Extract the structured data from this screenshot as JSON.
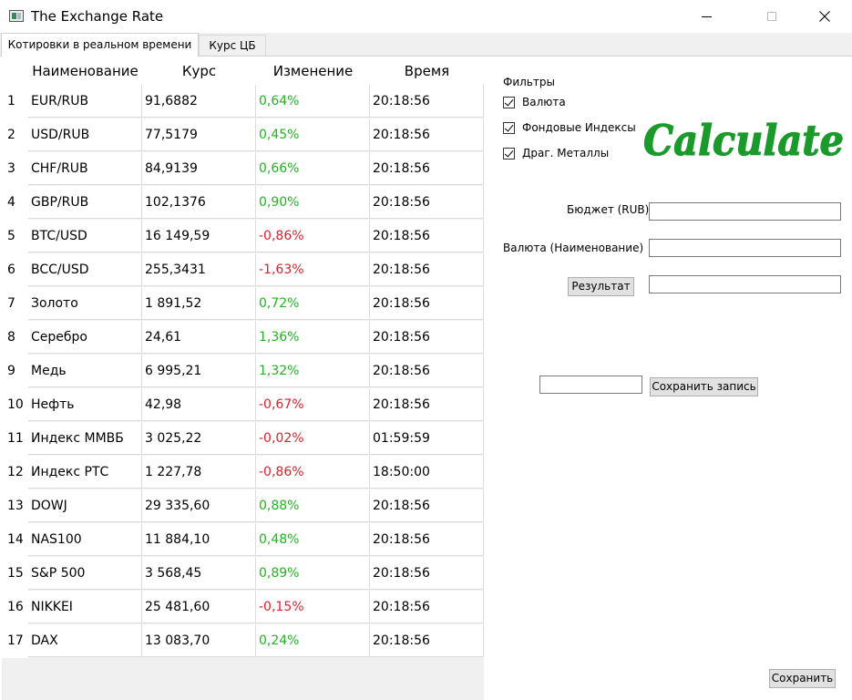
{
  "window": {
    "title": "The Exchange Rate"
  },
  "tabs": [
    {
      "label": "Котировки в реальном времени"
    },
    {
      "label": "Курс ЦБ"
    }
  ],
  "table": {
    "headers": [
      "Наименование",
      "Курс",
      "Изменение",
      "Время"
    ],
    "rows": [
      {
        "num": "1",
        "name": "EUR/RUB",
        "rate": "91,6882",
        "change": "0,64%",
        "time": "20:18:56"
      },
      {
        "num": "2",
        "name": "USD/RUB",
        "rate": "77,5179",
        "change": "0,45%",
        "time": "20:18:56"
      },
      {
        "num": "3",
        "name": "CHF/RUB",
        "rate": "84,9139",
        "change": "0,66%",
        "time": "20:18:56"
      },
      {
        "num": "4",
        "name": "GBP/RUB",
        "rate": "102,1376",
        "change": "0,90%",
        "time": "20:18:56"
      },
      {
        "num": "5",
        "name": "BTC/USD",
        "rate": "16 149,59",
        "change": "-0,86%",
        "time": "20:18:56"
      },
      {
        "num": "6",
        "name": "BCC/USD",
        "rate": "255,3431",
        "change": "-1,63%",
        "time": "20:18:56"
      },
      {
        "num": "7",
        "name": "Золото",
        "rate": "1 891,52",
        "change": "0,72%",
        "time": "20:18:56"
      },
      {
        "num": "8",
        "name": "Серебро",
        "rate": "24,61",
        "change": "1,36%",
        "time": "20:18:56"
      },
      {
        "num": "9",
        "name": "Медь",
        "rate": "6 995,21",
        "change": "1,32%",
        "time": "20:18:56"
      },
      {
        "num": "10",
        "name": "Нефть",
        "rate": "42,98",
        "change": "-0,67%",
        "time": "20:18:56"
      },
      {
        "num": "11",
        "name": "Индекс ММВБ",
        "rate": "3 025,22",
        "change": "-0,02%",
        "time": "01:59:59"
      },
      {
        "num": "12",
        "name": "Индекс РТС",
        "rate": "1 227,78",
        "change": "-0,86%",
        "time": "18:50:00"
      },
      {
        "num": "13",
        "name": "DOWJ",
        "rate": "29 335,60",
        "change": "0,88%",
        "time": "20:18:56"
      },
      {
        "num": "14",
        "name": "NAS100",
        "rate": "11 884,10",
        "change": "0,48%",
        "time": "20:18:56"
      },
      {
        "num": "15",
        "name": "S&P 500",
        "rate": "3 568,45",
        "change": "0,89%",
        "time": "20:18:56"
      },
      {
        "num": "16",
        "name": "NIKKEI",
        "rate": "25 481,60",
        "change": "-0,15%",
        "time": "20:18:56"
      },
      {
        "num": "17",
        "name": "DAX",
        "rate": "13 083,70",
        "change": "0,24%",
        "time": "20:18:56"
      }
    ]
  },
  "filters": {
    "label": "Фильтры",
    "items": [
      {
        "label": "Валюта",
        "checked": true
      },
      {
        "label": "Фондовые Индексы",
        "checked": true
      },
      {
        "label": "Драг. Металлы",
        "checked": true
      }
    ]
  },
  "logo": {
    "text": "Calculate",
    "color": "#1a9a2a"
  },
  "form": {
    "budget_label": "Бюджет (RUB)",
    "budget_value": "",
    "currency_label": "Валюта (Наименование)",
    "currency_value": "",
    "result_button": "Результат",
    "result_value": "",
    "record_value": "",
    "save_record_button": "Сохранить запись",
    "save_button": "Сохранить"
  },
  "colors": {
    "positive": "#22b422",
    "negative": "#e0202a"
  }
}
